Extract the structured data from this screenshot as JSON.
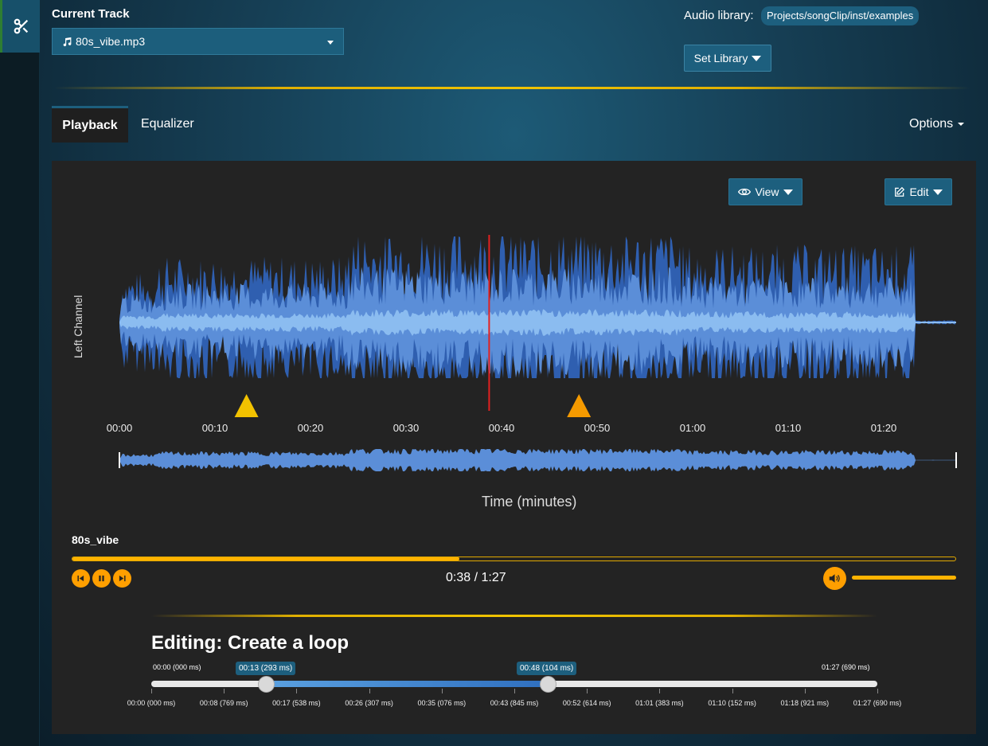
{
  "header": {
    "current_track_label": "Current Track",
    "track_value": "80s_vibe.mp3",
    "audio_library_label": "Audio library:",
    "audio_library_path": "Projects/songClip/inst/examples",
    "set_library_label": "Set Library"
  },
  "tabs": [
    {
      "label": "Playback",
      "active": true
    },
    {
      "label": "Equalizer",
      "active": false
    }
  ],
  "options_label": "Options",
  "toolbar": {
    "view_label": "View",
    "edit_label": "Edit"
  },
  "waveform": {
    "channel_label": "Left Channel",
    "axis_title": "Time (minutes)",
    "ticks": [
      "00:00",
      "00:10",
      "00:20",
      "00:30",
      "00:40",
      "00:50",
      "01:00",
      "01:10",
      "01:20"
    ],
    "playhead_seconds": 38.7,
    "marker_start_seconds": 13.3,
    "marker_end_seconds": 48.1,
    "duration_seconds": 87.7,
    "colors": {
      "outer": "#2f5fb0",
      "inner": "#5b8ed8",
      "core": "#8bbcf0",
      "playhead": "#e32020",
      "marker_start": "#f2c200",
      "marker_end": "#f59a00"
    }
  },
  "player": {
    "song_name": "80s_vibe",
    "current_time": "0:38",
    "separator": "/",
    "total_time": "1:27",
    "progress_fraction": 0.438,
    "volume_fraction": 1.0
  },
  "editing": {
    "title": "Editing: Create a loop",
    "min_label": "00:00 (000 ms)",
    "max_label": "01:27 (690 ms)",
    "handle_start_label": "00:13 (293 ms)",
    "handle_end_label": "00:48 (104 ms)",
    "grid_labels": [
      "00:00 (000 ms)",
      "00:08 (769 ms)",
      "00:17 (538 ms)",
      "00:26 (307 ms)",
      "00:35 (076 ms)",
      "00:43 (845 ms)",
      "00:52 (614 ms)",
      "01:01 (383 ms)",
      "01:10 (152 ms)",
      "01:18 (921 ms)",
      "01:27 (690 ms)"
    ]
  }
}
